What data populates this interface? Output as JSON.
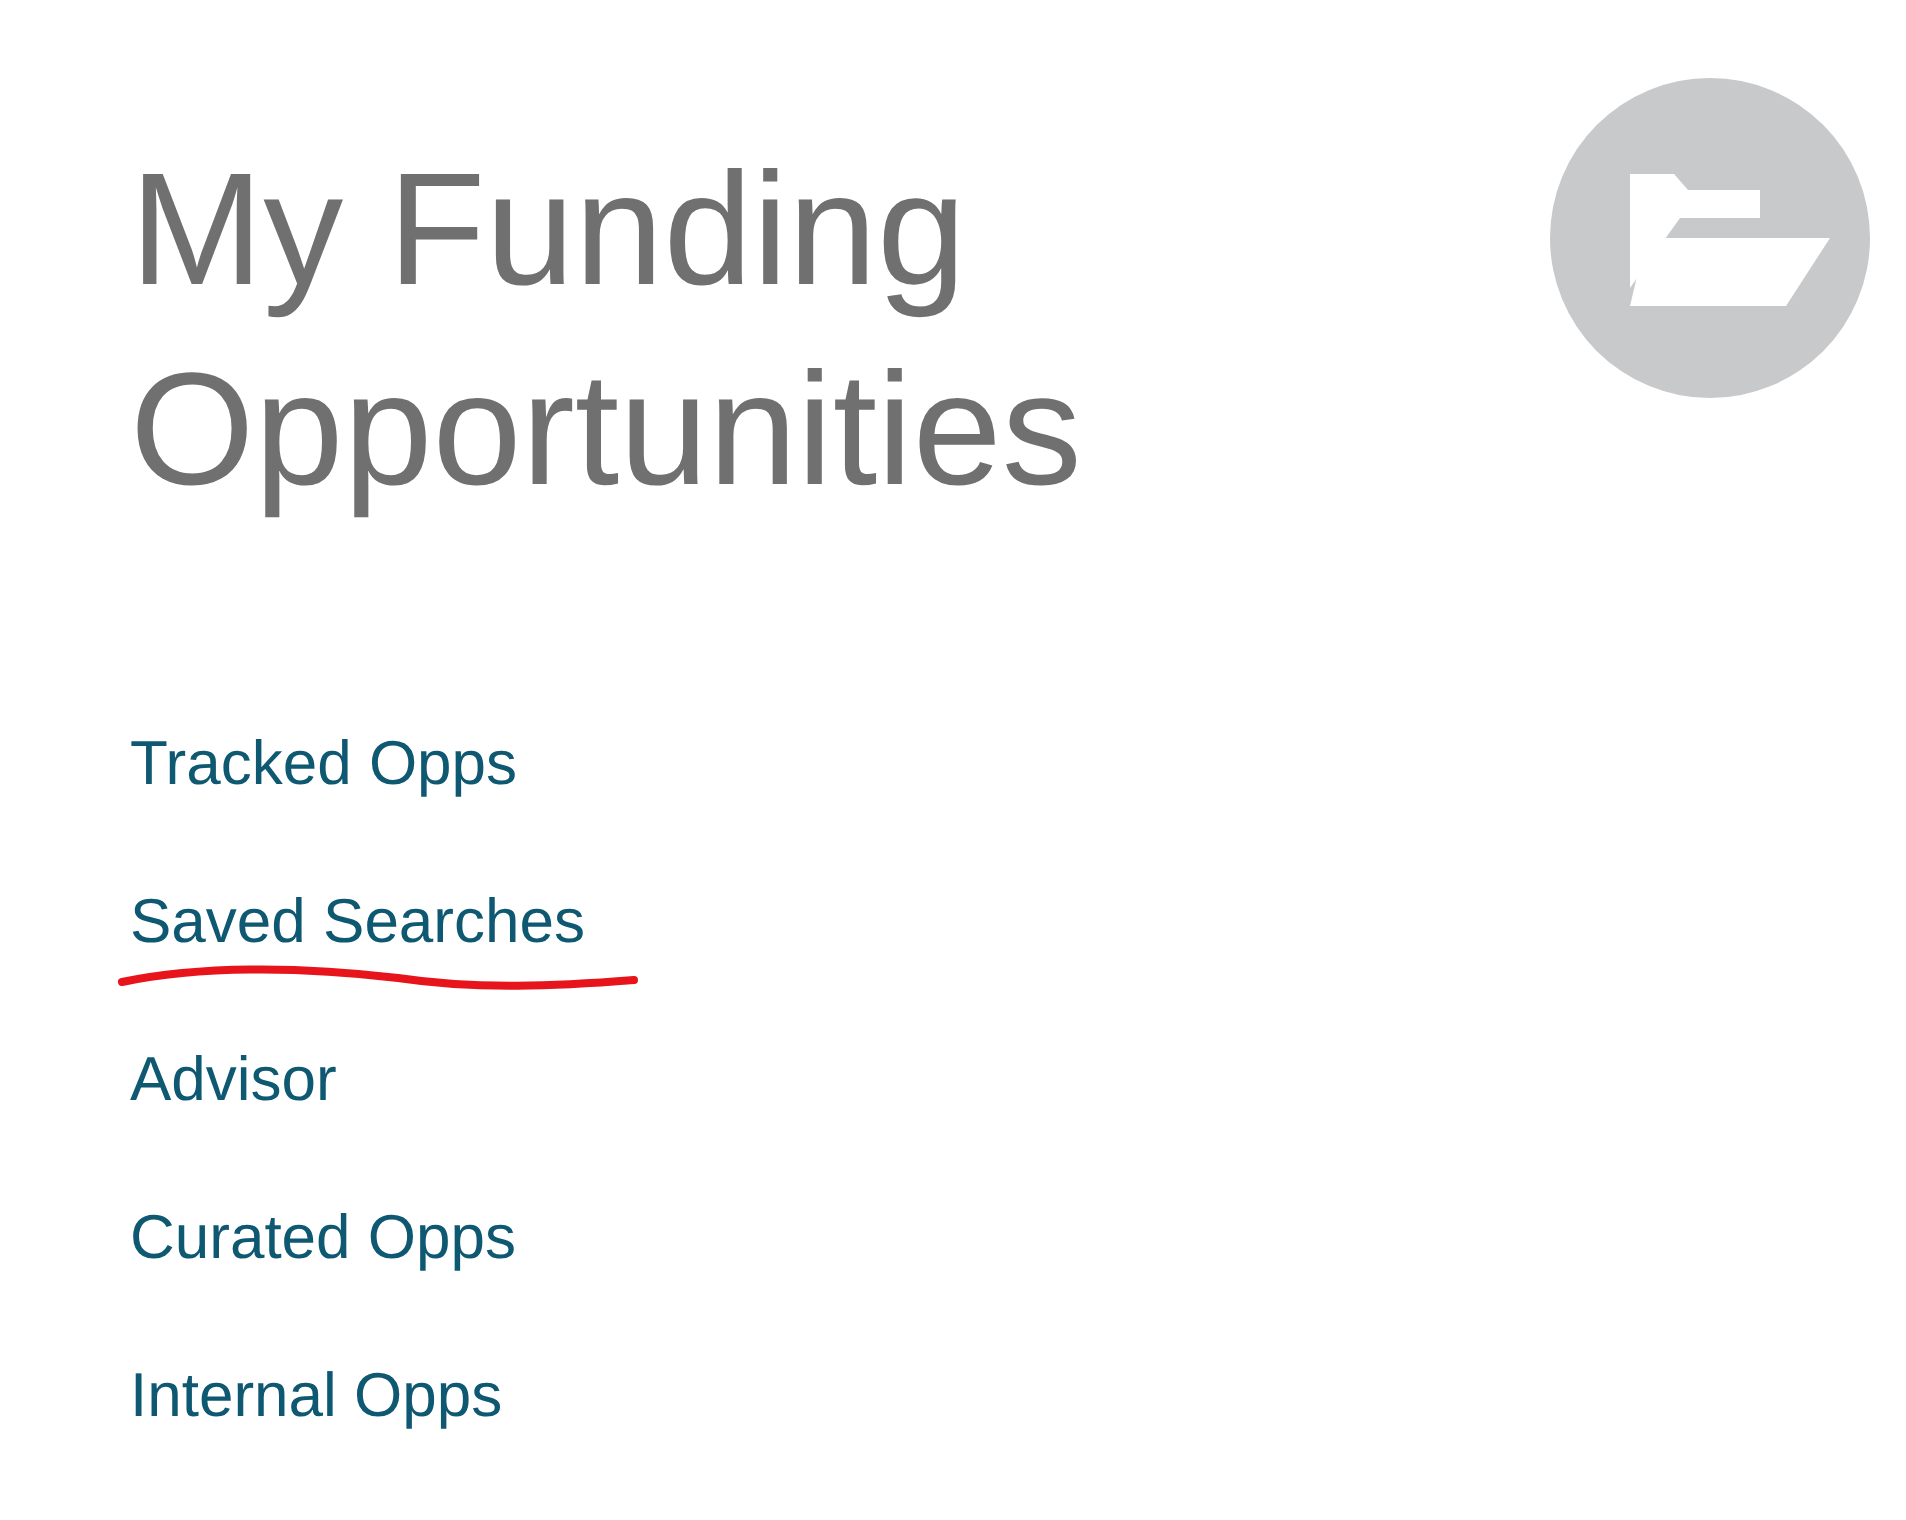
{
  "page": {
    "title": "My Funding Opportunities"
  },
  "links": [
    {
      "label": "Tracked Opps",
      "marked": false
    },
    {
      "label": "Saved Searches",
      "marked": true
    },
    {
      "label": "Advisor",
      "marked": false
    },
    {
      "label": "Curated Opps",
      "marked": false
    },
    {
      "label": "Internal Opps",
      "marked": false
    }
  ]
}
